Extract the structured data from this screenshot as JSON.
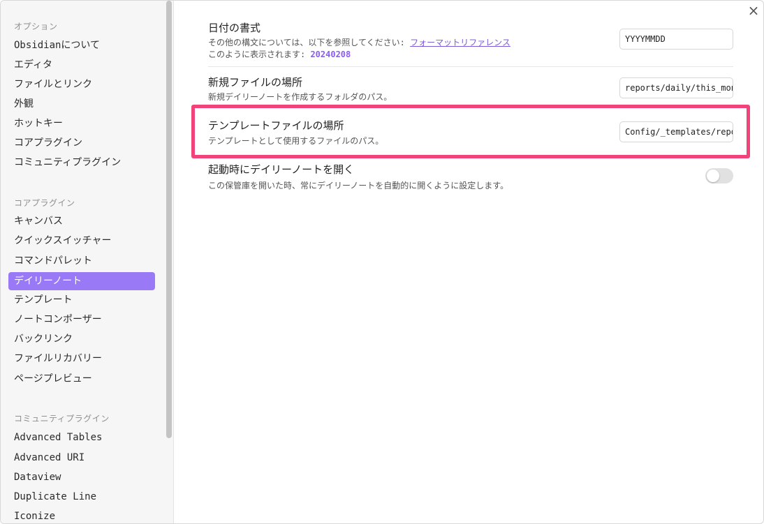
{
  "sidebar": {
    "options_heading": "オプション",
    "options_items": [
      "Obsidianについて",
      "エディタ",
      "ファイルとリンク",
      "外観",
      "ホットキー",
      "コアプラグイン",
      "コミュニティプラグイン"
    ],
    "core_heading": "コアプラグイン",
    "core_items": [
      "キャンバス",
      "クイックスイッチャー",
      "コマンドパレット",
      "デイリーノート",
      "テンプレート",
      "ノートコンポーザー",
      "バックリンク",
      "ファイルリカバリー",
      "ページプレビュー"
    ],
    "active_item": "デイリーノート",
    "community_heading": "コミュニティプラグイン",
    "community_items": [
      "Advanced Tables",
      "Advanced URI",
      "Dataview",
      "Duplicate Line",
      "Iconize"
    ]
  },
  "close_icon": "×",
  "settings": {
    "date_format": {
      "name": "日付の書式",
      "desc_prefix": "その他の構文については、以下を参照してください: ",
      "desc_link": "フォーマットリファレンス",
      "preview_prefix": "このように表示されます: ",
      "preview_value": "20240208",
      "value": "YYYYMMDD"
    },
    "new_file_location": {
      "name": "新規ファイルの場所",
      "desc": "新規デイリーノートを作成するフォルダのパス。",
      "value": "reports/daily/this_month"
    },
    "template_location": {
      "name": "テンプレートファイルの場所",
      "desc": "テンプレートとして使用するファイルのパス。",
      "value": "Config/_templates/reports/daily"
    },
    "open_on_startup": {
      "name": "起動時にデイリーノートを開く",
      "desc": "この保管庫を開いた時、常にデイリーノートを自動的に開くように設定します。",
      "enabled": false
    }
  },
  "colors": {
    "active_bg": "#9a79f7",
    "highlight_border": "#f0437a",
    "link": "#7b5bd6"
  }
}
